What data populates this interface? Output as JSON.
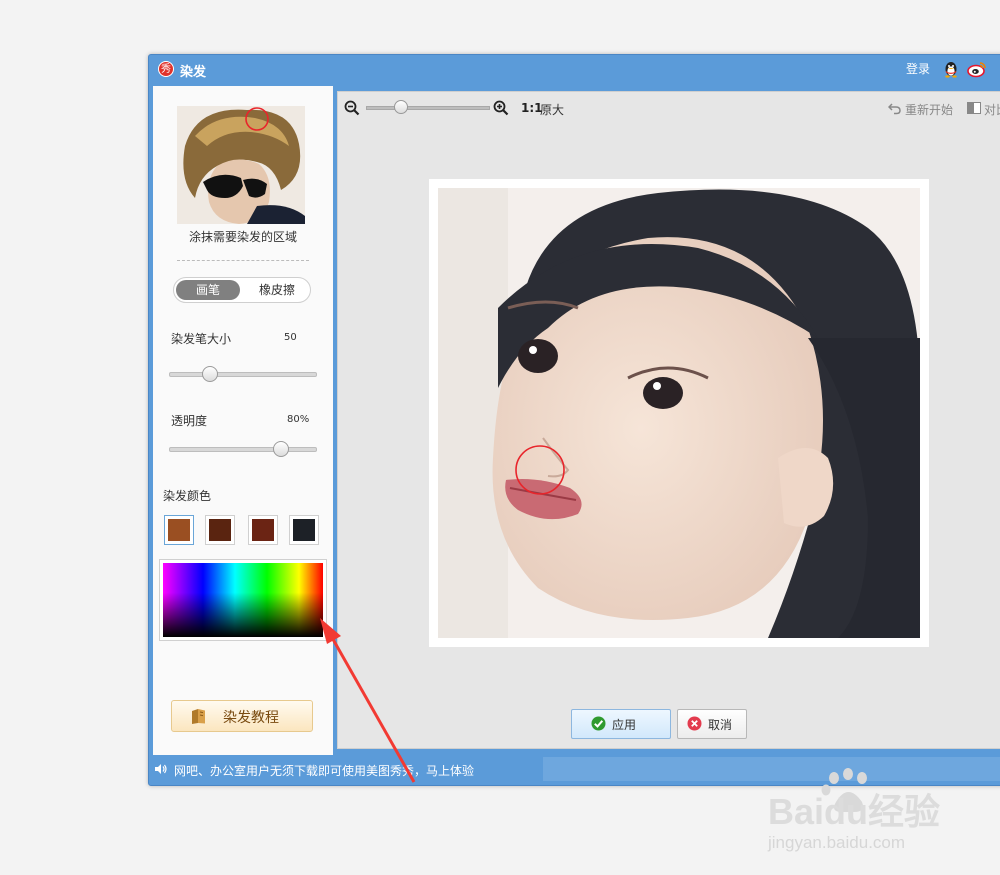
{
  "window": {
    "title": "染发",
    "app_icon_text": "秀",
    "login_label": "登录"
  },
  "left": {
    "sample_hint": "涂抹需要染发的区域",
    "tools": {
      "brush": "画笔",
      "eraser": "橡皮擦"
    },
    "brush_size": {
      "label": "染发笔大小",
      "value": "50",
      "level": 0.25
    },
    "opacity": {
      "label": "透明度",
      "value": "80%",
      "level": 0.8
    },
    "color_label": "染发颜色",
    "swatches": [
      "#9a4f22",
      "#5a2410",
      "#6b2414",
      "#1d2127"
    ],
    "tutorial_label": "染发教程"
  },
  "toolbar": {
    "ratio_label": "1:1",
    "actual_size_label": "原大",
    "restart_label": "重新开始",
    "compare_label": "对比",
    "zoom_level": 0.25
  },
  "actions": {
    "apply_label": "应用",
    "cancel_label": "取消"
  },
  "status": {
    "message": "网吧、办公室用户无须下载即可使用美图秀秀，马上体验"
  },
  "watermark": {
    "brand": "Baidu经验",
    "url": "jingyan.baidu.com"
  },
  "colors": {
    "title_bar": "#5b9bd9",
    "brush_indicator": "#e8252b",
    "annotation_arrow": "#f23a33"
  }
}
